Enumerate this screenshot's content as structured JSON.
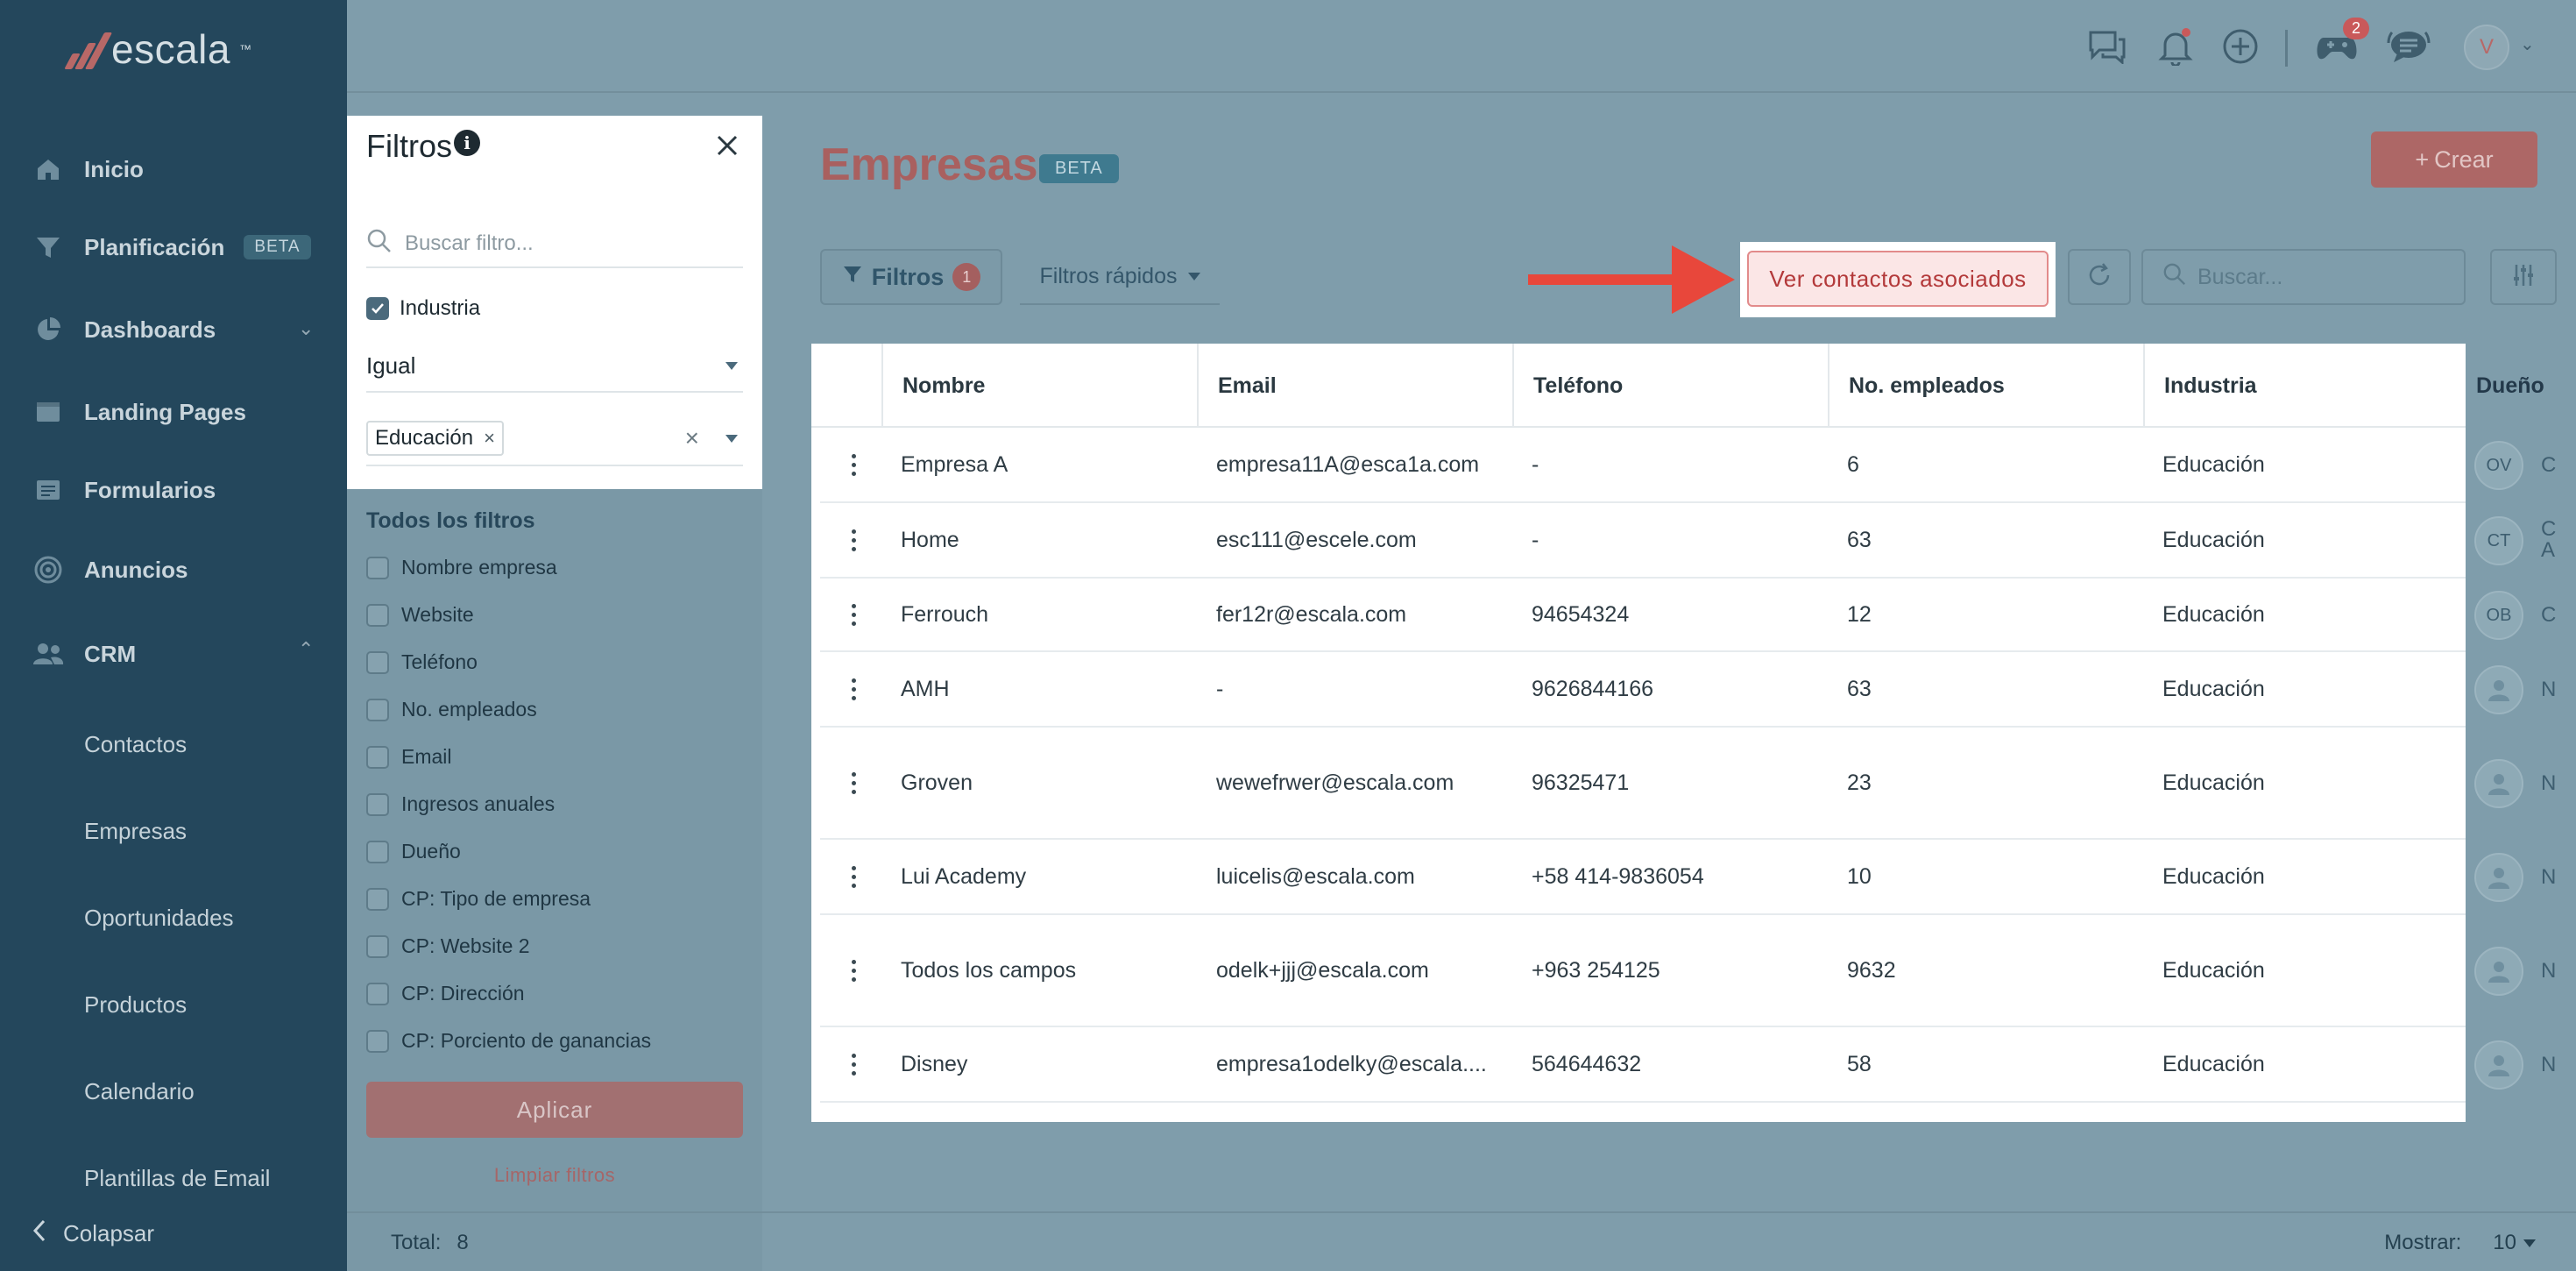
{
  "app": {
    "logo_text": "escala",
    "logo_tm": "™"
  },
  "sidebar": {
    "items": [
      {
        "label": "Inicio",
        "icon": "home-icon"
      },
      {
        "label": "Planificación",
        "icon": "funnel-icon",
        "badge": "BETA"
      },
      {
        "label": "Dashboards",
        "icon": "pie-chart-icon"
      },
      {
        "label": "Landing Pages",
        "icon": "browser-icon"
      },
      {
        "label": "Formularios",
        "icon": "form-icon"
      },
      {
        "label": "Anuncios",
        "icon": "target-icon"
      },
      {
        "label": "CRM",
        "icon": "users-icon"
      }
    ],
    "crm_sub": [
      "Contactos",
      "Empresas",
      "Oportunidades",
      "Productos",
      "Calendario",
      "Plantillas de Email"
    ],
    "collapse_label": "Colapsar"
  },
  "topbar": {
    "notifications_badge": "2",
    "avatar_initial": "V"
  },
  "filters_panel": {
    "title": "Filtros",
    "search_placeholder": "Buscar filtro...",
    "active_filter": {
      "field": "Industria",
      "operator": "Igual",
      "values": [
        "Educación"
      ]
    },
    "all_title": "Todos los filtros",
    "options": [
      "Nombre empresa",
      "Website",
      "Teléfono",
      "No. empleados",
      "Email",
      "Ingresos anuales",
      "Dueño",
      "CP: Tipo de empresa",
      "CP: Website 2",
      "CP: Dirección",
      "CP: Porciento de ganancias"
    ],
    "apply_label": "Aplicar",
    "clear_label": "Limpiar filtros"
  },
  "main": {
    "title": "Empresas",
    "title_badge": "BETA",
    "create_label": "Crear",
    "filters_label": "Filtros",
    "filters_count": "1",
    "quick_filters_label": "Filtros rápidos",
    "associated_label": "Ver contactos asociados",
    "search_placeholder": "Buscar..."
  },
  "table": {
    "columns": [
      "Nombre",
      "Email",
      "Teléfono",
      "No. empleados",
      "Industria",
      "Dueño"
    ],
    "rows": [
      {
        "nombre": "Empresa A",
        "email": "empresa11A@esca1a.com",
        "telefono": "-",
        "empleados": "6",
        "industria": "Educación",
        "owner_initials": "OV",
        "owner_text": "C"
      },
      {
        "nombre": "Home",
        "email": "esc111@escele.com",
        "telefono": "-",
        "empleados": "63",
        "industria": "Educación",
        "owner_initials": "CT",
        "owner_text": "C\nA"
      },
      {
        "nombre": "Ferrouch",
        "email": "fer12r@escala.com",
        "telefono": "94654324",
        "empleados": "12",
        "industria": "Educación",
        "owner_initials": "OB",
        "owner_text": "C"
      },
      {
        "nombre": "AMH",
        "email": "-",
        "telefono": "9626844166",
        "empleados": "63",
        "industria": "Educación",
        "owner_initials": "",
        "owner_text": "N"
      },
      {
        "nombre": "Groven",
        "email": "wewefrwer@escala.com",
        "telefono": "96325471",
        "empleados": "23",
        "industria": "Educación",
        "owner_initials": "",
        "owner_text": "N"
      },
      {
        "nombre": "Lui Academy",
        "email": "luicelis@escala.com",
        "telefono": "+58 414-9836054",
        "empleados": "10",
        "industria": "Educación",
        "owner_initials": "",
        "owner_text": "N"
      },
      {
        "nombre": "Todos los campos",
        "email": "odelk+jjj@escala.com",
        "telefono": "+963 254125",
        "empleados": "9632",
        "industria": "Educación",
        "owner_initials": "",
        "owner_text": "N"
      },
      {
        "nombre": "Disney",
        "email": "empresa1odelky@escala....",
        "telefono": "564644632",
        "empleados": "58",
        "industria": "Educación",
        "owner_initials": "",
        "owner_text": "N"
      }
    ]
  },
  "footer": {
    "total_label": "Total:",
    "total_value": "8",
    "show_label": "Mostrar:",
    "show_value": "10"
  },
  "colors": {
    "sidebar_bg": "#24475c",
    "overlay_bg": "#7f9dab",
    "brand_red": "#ad6766",
    "highlight_red": "#b3393a",
    "arrow_red": "#e8473b"
  }
}
